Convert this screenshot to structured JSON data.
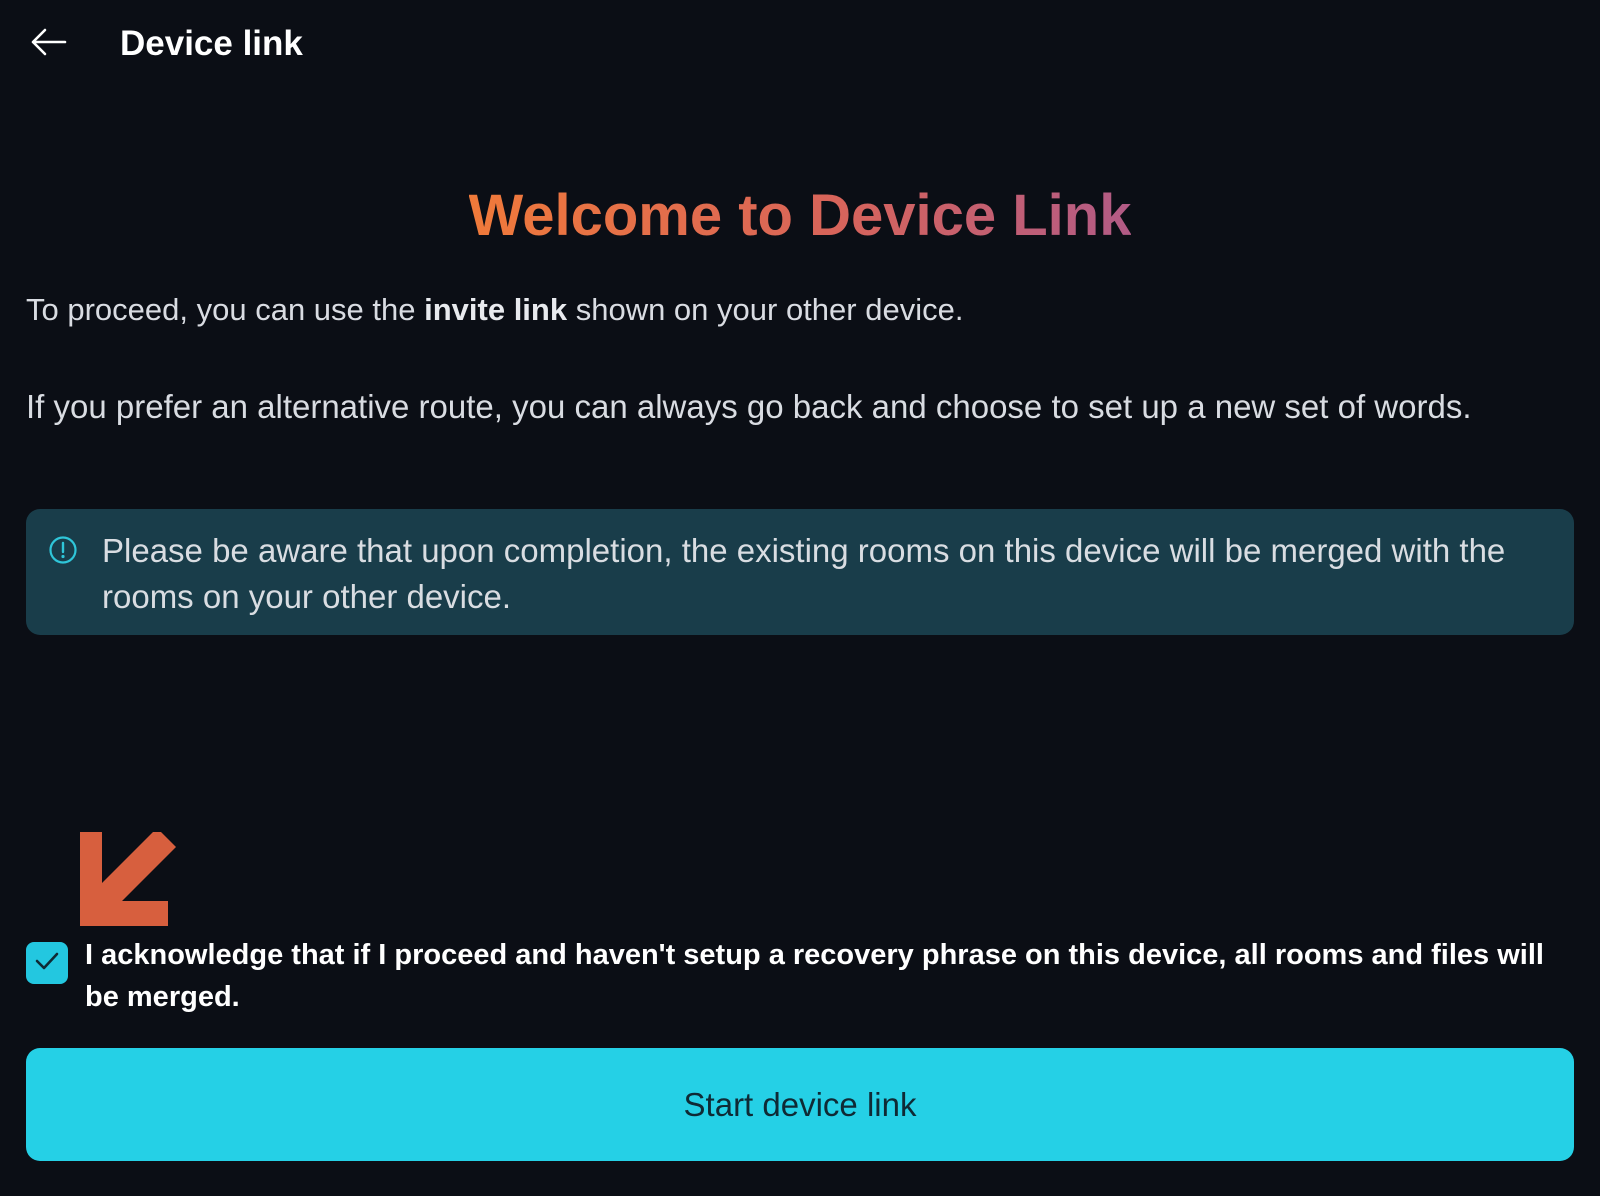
{
  "header": {
    "back_icon": "arrow-left-icon",
    "title": "Device link"
  },
  "welcome": {
    "title": "Welcome to Device Link",
    "gradient_colors": [
      "#f07a3a",
      "#d8645a",
      "#b25b86"
    ]
  },
  "intro": {
    "before": "To proceed, you can use the ",
    "bold": "invite link",
    "after": " shown on your other device."
  },
  "alt_route": "If you prefer an alternative route, you can always go back and choose to set up a new set of words.",
  "notice": {
    "icon": "info-circle-icon",
    "text": "Please be aware that upon completion, the existing rooms on this device will be merged with the rooms on your other device.",
    "background": "#193d4a"
  },
  "annotation": {
    "icon": "arrow-down-left-icon",
    "color": "#d75f3e"
  },
  "acknowledge": {
    "checked": true,
    "icon": "check-icon",
    "text": "I acknowledge that if I proceed and haven't setup a recovery phrase on this device, all rooms and files will be merged."
  },
  "start_button": {
    "label": "Start device link",
    "color": "#25d0e6"
  }
}
